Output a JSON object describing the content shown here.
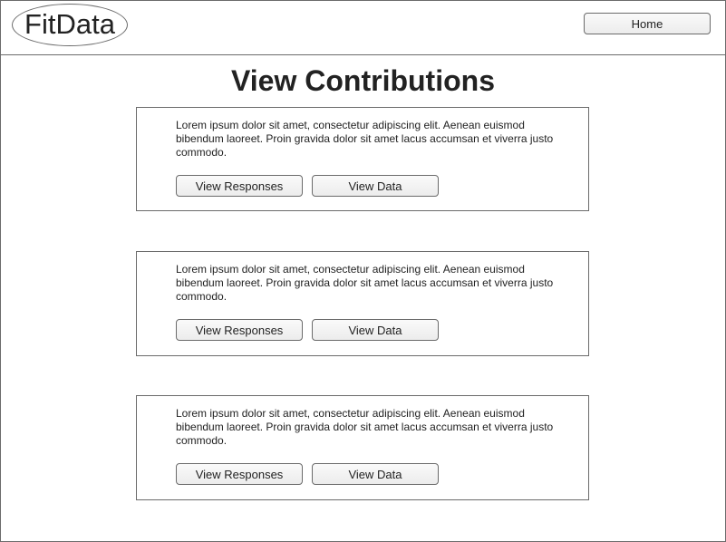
{
  "header": {
    "logo_text": "FitData",
    "home_label": "Home"
  },
  "page": {
    "title": "View Contributions"
  },
  "contributions": [
    {
      "description": "Lorem ipsum dolor sit amet, consectetur adipiscing elit. Aenean euismod bibendum laoreet. Proin gravida dolor sit amet lacus accumsan et viverra justo commodo.",
      "view_responses_label": "View Responses",
      "view_data_label": "View Data"
    },
    {
      "description": "Lorem ipsum dolor sit amet, consectetur adipiscing elit. Aenean euismod bibendum laoreet. Proin gravida dolor sit amet lacus accumsan et viverra justo commodo.",
      "view_responses_label": "View Responses",
      "view_data_label": "View Data"
    },
    {
      "description": "Lorem ipsum dolor sit amet, consectetur adipiscing elit. Aenean euismod bibendum laoreet. Proin gravida dolor sit amet lacus accumsan et viverra justo commodo.",
      "view_responses_label": "View Responses",
      "view_data_label": "View Data"
    }
  ]
}
